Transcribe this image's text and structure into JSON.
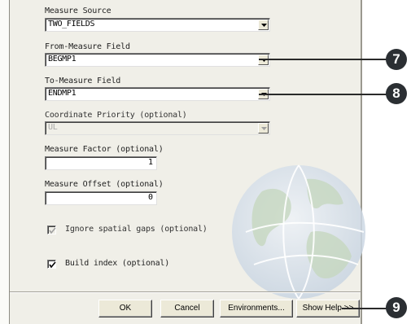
{
  "form": {
    "measure_source": {
      "label": "Measure Source",
      "value": "TWO_FIELDS"
    },
    "from_measure_field": {
      "label": "From-Measure Field",
      "value": "BEGMP1"
    },
    "to_measure_field": {
      "label": "To-Measure Field",
      "value": "ENDMP1"
    },
    "coordinate_priority": {
      "label": "Coordinate Priority (optional)",
      "value": "UL"
    },
    "measure_factor": {
      "label": "Measure Factor (optional)",
      "value": "1"
    },
    "measure_offset": {
      "label": "Measure Offset (optional)",
      "value": "0"
    },
    "ignore_spatial_gaps": {
      "label": "Ignore spatial gaps (optional)",
      "checked": true,
      "enabled": false
    },
    "build_index": {
      "label": "Build index (optional)",
      "checked": true,
      "enabled": true
    }
  },
  "buttons": {
    "ok": "OK",
    "cancel": "Cancel",
    "environments": "Environments...",
    "show_help": "Show Help >>"
  },
  "callouts": {
    "c7": "7",
    "c8": "8",
    "c9": "9"
  }
}
